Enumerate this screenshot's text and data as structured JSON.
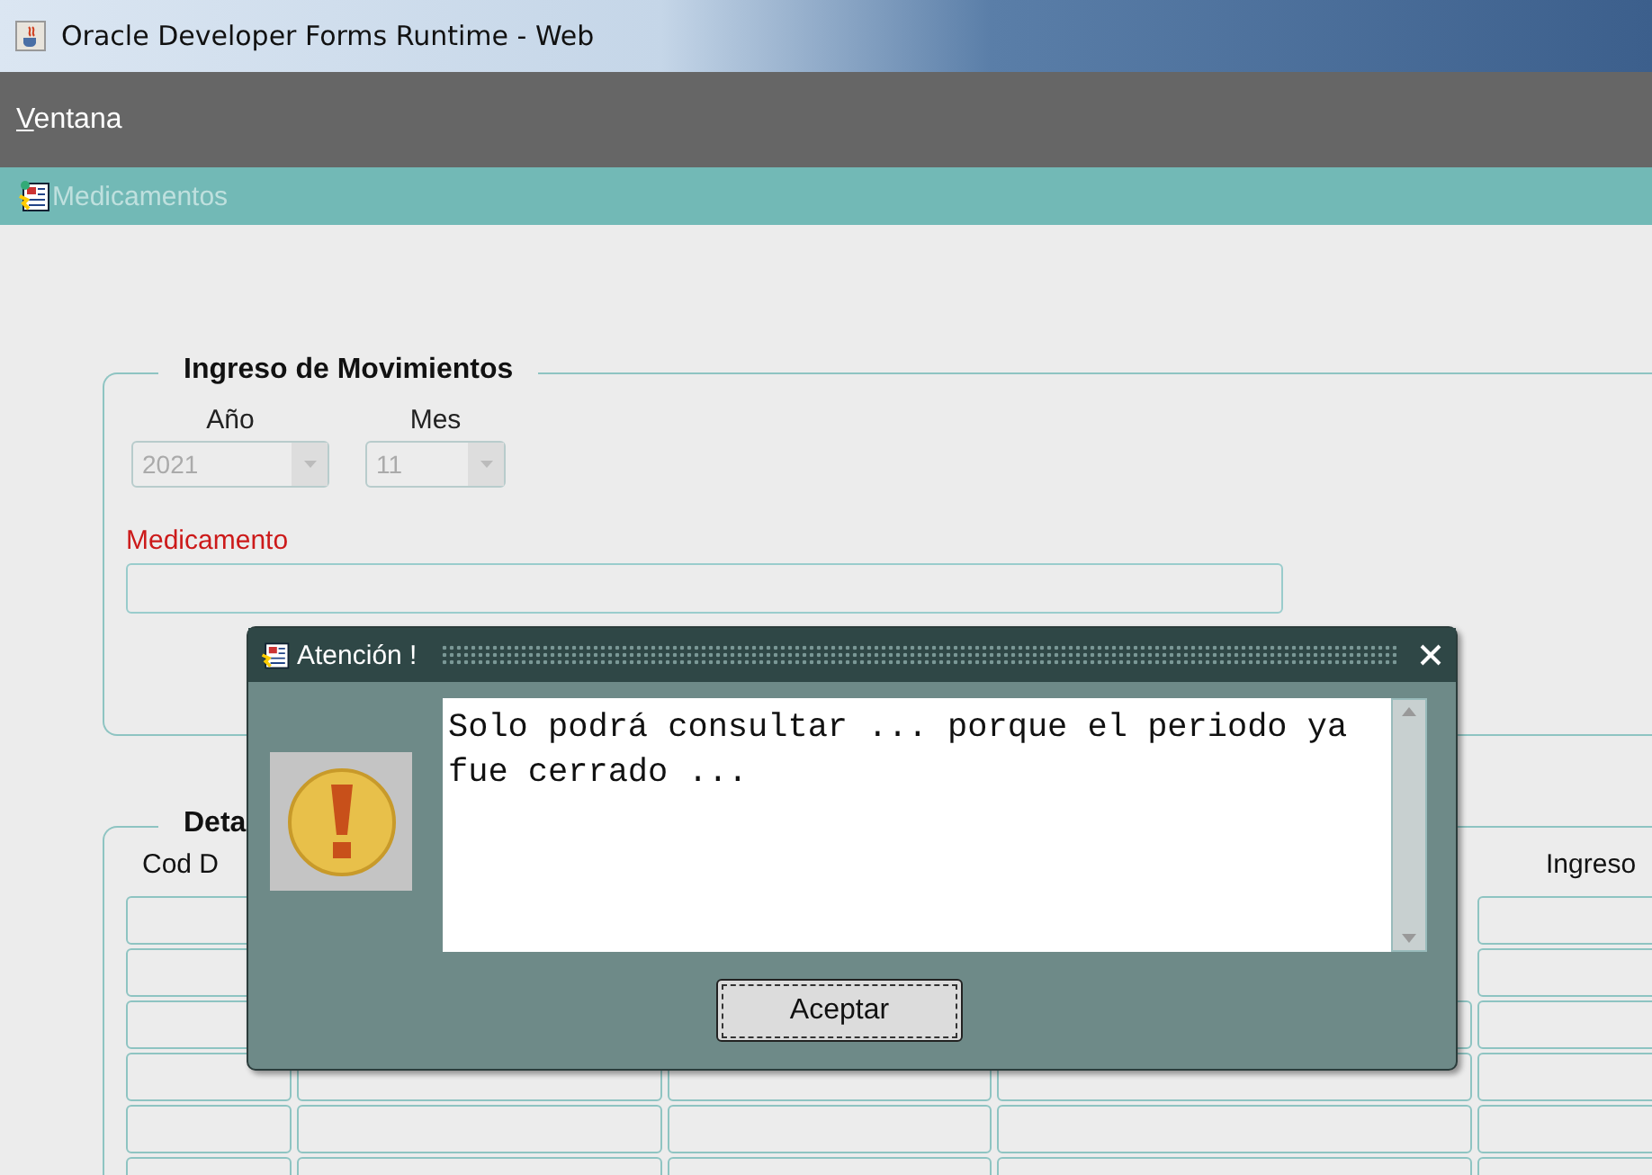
{
  "window": {
    "title": "Oracle Developer Forms Runtime - Web"
  },
  "menu": [
    {
      "label": "Ventana"
    }
  ],
  "form": {
    "title": "Medicamentos"
  },
  "movements": {
    "title": "Ingreso de Movimientos",
    "year": {
      "label": "Año",
      "value": "2021",
      "disabled": true
    },
    "month": {
      "label": "Mes",
      "value": "11",
      "disabled": true
    },
    "medicine": {
      "label": "Medicamento",
      "required": true
    }
  },
  "detail": {
    "title": "Deta",
    "columns": [
      "Cod D",
      "Ingreso"
    ]
  },
  "dialog": {
    "title": "Atención !",
    "message": "Solo podrá consultar ... porque el periodo ya fue cerrado ...",
    "buttons": [
      "Aceptar"
    ]
  }
}
